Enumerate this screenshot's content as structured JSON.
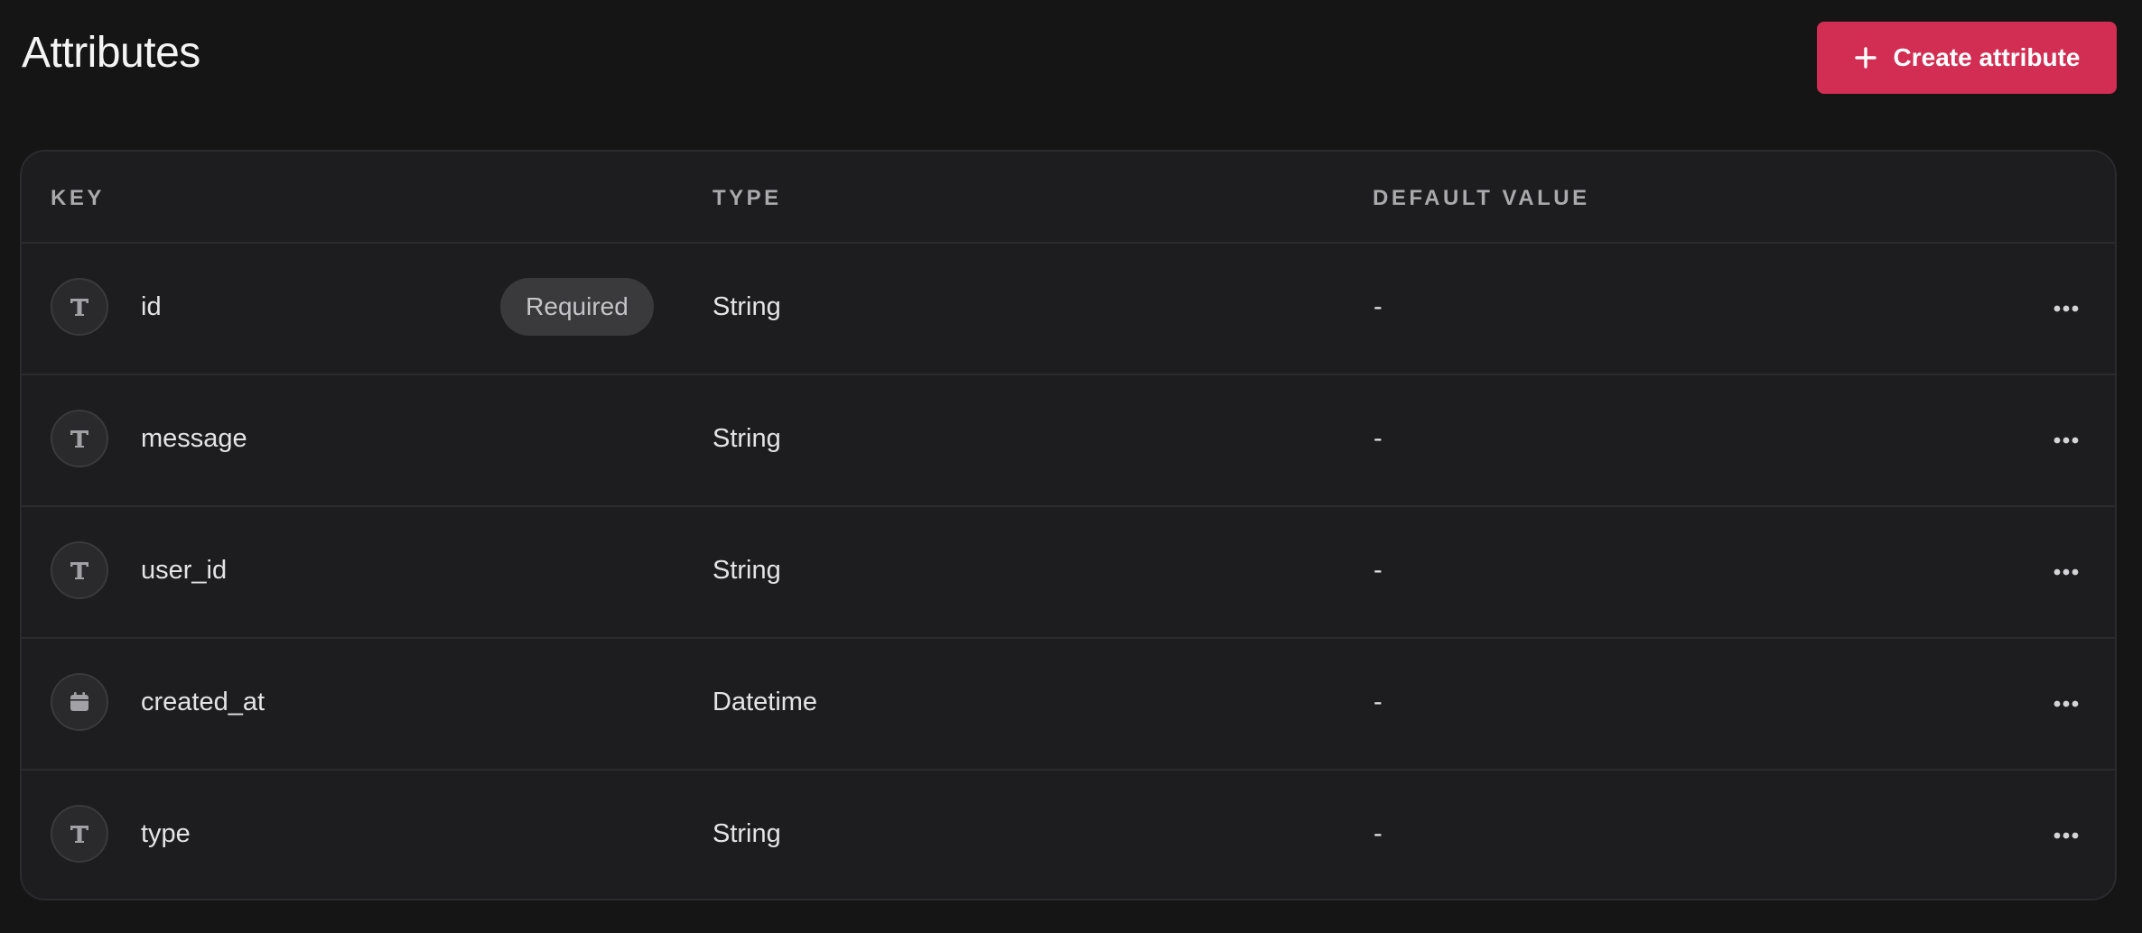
{
  "header": {
    "title": "Attributes",
    "create_button_label": "Create attribute"
  },
  "table": {
    "columns": {
      "key": "KEY",
      "type": "TYPE",
      "default_value": "DEFAULT VALUE"
    },
    "rows": [
      {
        "icon": "text-type-icon",
        "key": "id",
        "badge": "Required",
        "type": "String",
        "default": "-"
      },
      {
        "icon": "text-type-icon",
        "key": "message",
        "type": "String",
        "default": "-"
      },
      {
        "icon": "text-type-icon",
        "key": "user_id",
        "type": "String",
        "default": "-"
      },
      {
        "icon": "calendar-icon",
        "key": "created_at",
        "type": "Datetime",
        "default": "-"
      },
      {
        "icon": "text-type-icon",
        "key": "type",
        "type": "String",
        "default": "-"
      }
    ]
  },
  "colors": {
    "background": "#151516",
    "card": "#1d1d1f",
    "accent": "#d22d52",
    "border": "#2b2b2e"
  }
}
